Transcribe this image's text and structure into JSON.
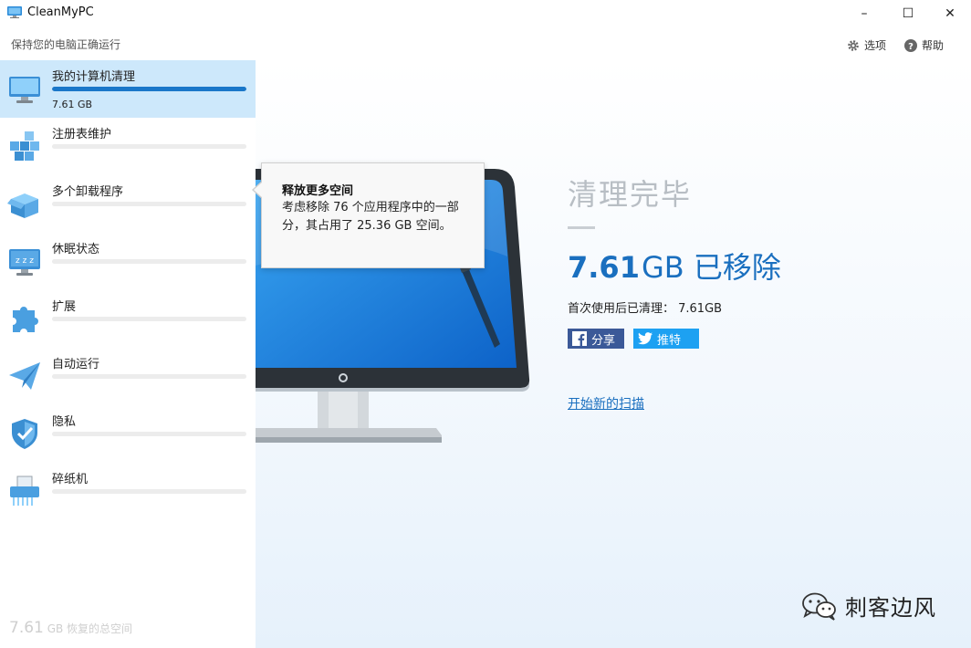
{
  "window": {
    "title": "CleanMyPC",
    "min": "–",
    "max": "☐",
    "close": "✕"
  },
  "header": {
    "subtitle": "保持您的电脑正确运行",
    "options_label": "选项",
    "help_label": "帮助"
  },
  "sidebar": {
    "items": [
      {
        "label": "我的计算机清理",
        "size": "7.61 GB",
        "active": true,
        "progress": 1.0,
        "icon": "monitor-icon"
      },
      {
        "label": "注册表维护",
        "icon": "registry-cubes-icon"
      },
      {
        "label": "多个卸载程序",
        "icon": "uninstall-box-icon"
      },
      {
        "label": "休眠状态",
        "icon": "sleep-monitor-icon"
      },
      {
        "label": "扩展",
        "icon": "puzzle-icon"
      },
      {
        "label": "自动运行",
        "icon": "paper-plane-icon"
      },
      {
        "label": "隐私",
        "icon": "shield-icon"
      },
      {
        "label": "碎纸机",
        "icon": "shredder-icon"
      }
    ],
    "total_value": "7.61",
    "total_text": "GB 恢复的总空间"
  },
  "tooltip": {
    "title": "释放更多空间",
    "body": "考虑移除 76 个应用程序中的一部分，其占用了 25.36 GB 空间。"
  },
  "result": {
    "title": "清理完毕",
    "removed_value": "7.61",
    "removed_unit": "GB 已移除",
    "since_first_use": "首次使用后已清理：  7.61GB",
    "share_facebook": "分享",
    "share_twitter": "推特",
    "new_scan": "开始新的扫描"
  },
  "watermark": {
    "text": "刺客边风"
  },
  "colors": {
    "accent": "#1a6fbf",
    "active_bg": "#cde8fb",
    "progress": "#1a77c9",
    "facebook": "#3b5998",
    "twitter": "#1da1f2"
  }
}
